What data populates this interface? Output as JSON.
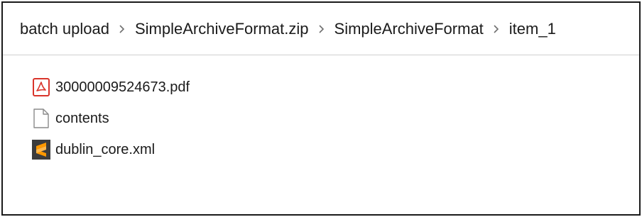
{
  "breadcrumb": {
    "items": [
      {
        "label": "batch upload"
      },
      {
        "label": "SimpleArchiveFormat.zip"
      },
      {
        "label": "SimpleArchiveFormat"
      },
      {
        "label": "item_1"
      }
    ],
    "separator_icon": "chevron-right-icon"
  },
  "files": [
    {
      "name": "30000009524673.pdf",
      "icon": "pdf-file-icon",
      "icon_color": "#d9342b"
    },
    {
      "name": "contents",
      "icon": "blank-file-icon",
      "icon_color": "#8a8a8a"
    },
    {
      "name": "dublin_core.xml",
      "icon": "sublime-text-file-icon",
      "icon_color": "#ff9800"
    }
  ]
}
